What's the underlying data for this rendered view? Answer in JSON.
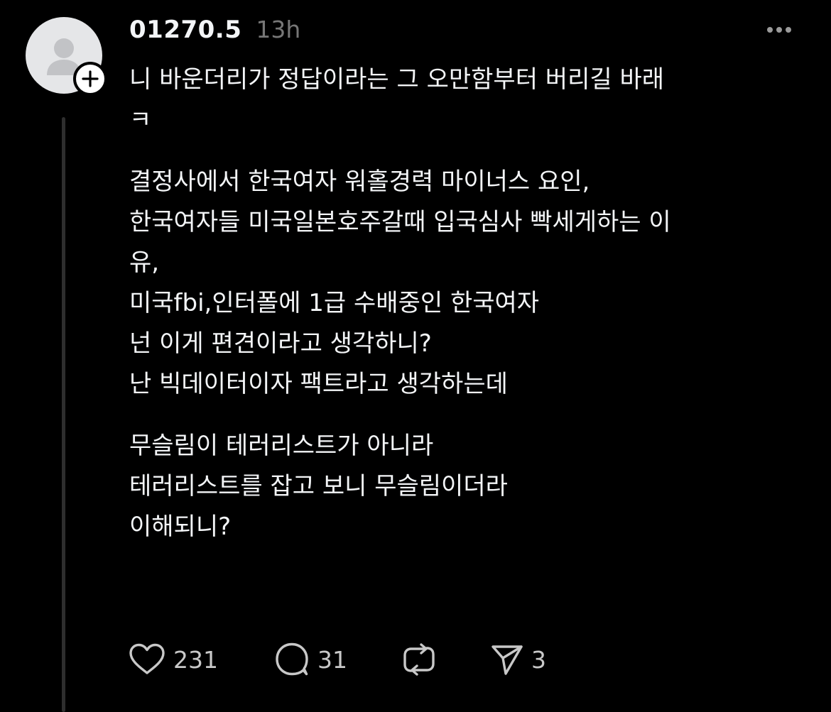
{
  "post": {
    "username": "01270.5",
    "timestamp": "13h",
    "paragraphs": [
      {
        "lines": [
          "니  바운더리가 정답이라는 그 오만함부터 버리길 바래",
          "ㅋ"
        ]
      },
      {
        "lines": [
          "결정사에서 한국여자 워홀경력 마이너스 요인,",
          "한국여자들 미국일본호주갈때 입국심사 빡세게하는 이",
          "유,",
          "미국fbi,인터폴에 1급 수배중인 한국여자",
          "넌 이게 편견이라고 생각하니?",
          "난 빅데이터이자 팩트라고 생각하는데"
        ]
      },
      {
        "lines": [
          "무슬림이 테러리스트가 아니라",
          "테러리스트를 잡고 보니 무슬림이더라",
          "이해되니?"
        ]
      }
    ]
  },
  "actions": {
    "like_count": "231",
    "comment_count": "31",
    "repost_count": "",
    "share_count": "3"
  },
  "icons": {
    "avatar": "default-avatar-icon",
    "follow": "plus-icon",
    "more": "more-horizontal-icon",
    "like": "heart-icon",
    "comment": "comment-bubble-icon",
    "repost": "repost-icon",
    "share": "send-icon"
  },
  "colors": {
    "background": "#000000",
    "text": "#f3f5f7",
    "muted": "#777777",
    "icon": "#c8c8c8"
  }
}
